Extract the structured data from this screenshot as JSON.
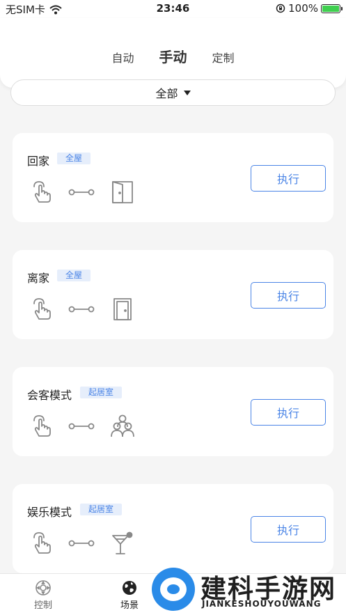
{
  "status_bar": {
    "carrier": "无SIM卡",
    "time": "23:46",
    "battery": "100%",
    "battery_level": 1.0
  },
  "tabs": [
    {
      "label": "自动",
      "active": false
    },
    {
      "label": "手动",
      "active": true
    },
    {
      "label": "定制",
      "active": false
    }
  ],
  "filter": {
    "label": "全部"
  },
  "scenes": [
    {
      "title": "回家",
      "tag": "全屋",
      "target_icon": "open-door-icon",
      "action": "执行"
    },
    {
      "title": "离家",
      "tag": "全屋",
      "target_icon": "closed-door-icon",
      "action": "执行"
    },
    {
      "title": "会客模式",
      "tag": "起居室",
      "target_icon": "guests-icon",
      "action": "执行"
    },
    {
      "title": "娱乐模式",
      "tag": "起居室",
      "target_icon": "cocktail-icon",
      "action": "执行"
    }
  ],
  "bottom_nav": [
    {
      "label": "控制",
      "icon": "control-icon",
      "active": false
    },
    {
      "label": "场景",
      "icon": "scene-globe-icon",
      "active": true
    }
  ],
  "watermark": {
    "title": "建科手游网",
    "subtitle": "JIANKESHOUYOUWANG"
  },
  "colors": {
    "accent": "#4a84e6",
    "tag_bg": "#e6eefb",
    "page_bg": "#f5f5f5",
    "battery": "#3fcf4f",
    "watermark_blue": "#2a8be8"
  }
}
